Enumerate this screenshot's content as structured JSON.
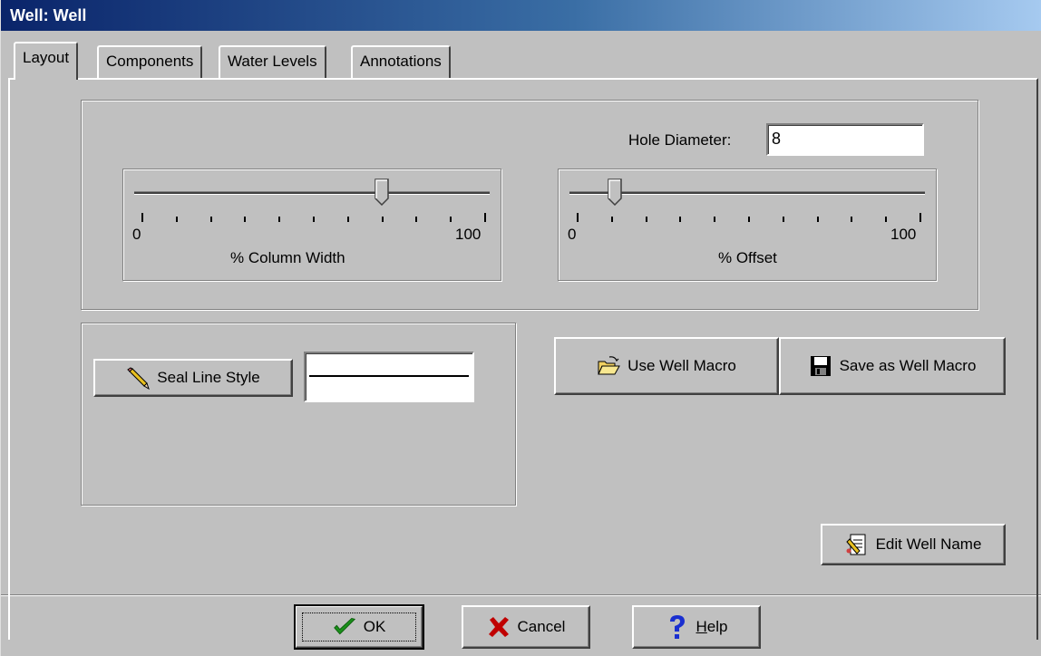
{
  "window": {
    "title": "Well: Well"
  },
  "tabs": [
    {
      "label": "Layout"
    },
    {
      "label": "Components"
    },
    {
      "label": "Water Levels"
    },
    {
      "label": "Annotations"
    }
  ],
  "layout": {
    "hole_diameter_label": "Hole Diameter:",
    "hole_diameter_value": "8",
    "column_width_slider": {
      "label": "% Column Width",
      "min_label": "0",
      "max_label": "100",
      "value_percent": 70
    },
    "offset_slider": {
      "label": "% Offset",
      "min_label": "0",
      "max_label": "100",
      "value_percent": 11
    },
    "seal_line_style_label": "Seal Line Style",
    "use_well_macro_label": "Use Well Macro",
    "save_well_macro_label": "Save as Well Macro",
    "edit_well_name_label": "Edit Well Name"
  },
  "footer": {
    "ok_label": "OK",
    "cancel_label": "Cancel",
    "help_label": "Help"
  },
  "colors": {
    "title_start": "#0a246a",
    "title_end": "#a6caf0",
    "face": "#c0c0c0",
    "ok_check": "#1a8f1a",
    "cancel_x": "#c00000",
    "help_q": "#1a2fd0"
  }
}
